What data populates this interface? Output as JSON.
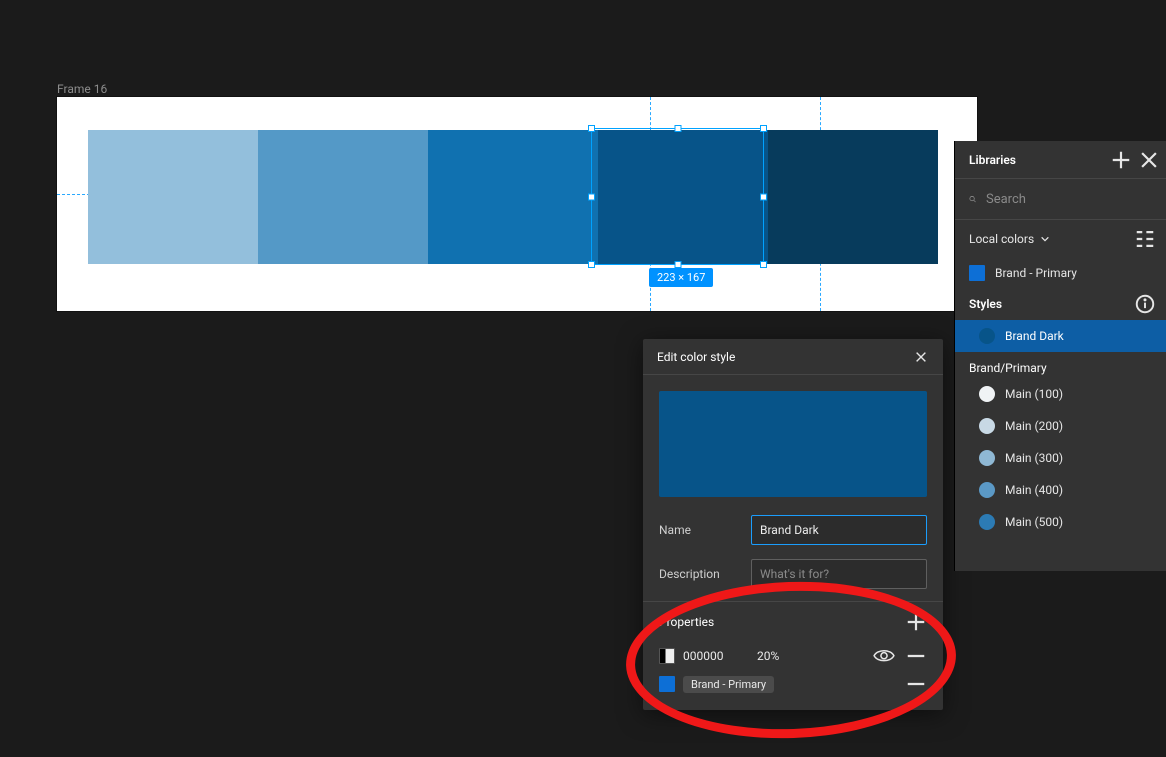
{
  "canvas": {
    "frame_label": "Frame 16",
    "dimension_badge": "223 × 167",
    "swatch_colors": [
      "#93bfdc",
      "#5499c7",
      "#1071b0",
      "#075489",
      "#073b5c"
    ],
    "selected_index": 3
  },
  "edit_panel": {
    "title": "Edit color style",
    "preview_color": "#075489",
    "name_label": "Name",
    "name_value": "Brand Dark",
    "description_label": "Description",
    "description_placeholder": "What's it for?",
    "properties_label": "Properties",
    "overlay": {
      "hex": "000000",
      "opacity": "20%"
    },
    "fill": {
      "name": "Brand - Primary",
      "color": "#0d6fd6"
    }
  },
  "libraries": {
    "title": "Libraries",
    "search_placeholder": "Search",
    "local_label": "Local colors",
    "brand_primary": {
      "label": "Brand - Primary",
      "color": "#0d6fd6"
    },
    "styles_heading": "Styles",
    "selected_style": "Brand Dark",
    "group_label": "Brand/Primary",
    "items": [
      {
        "label": "Main (100)",
        "color": "#f0f3f5"
      },
      {
        "label": "Main (200)",
        "color": "#c8d9e5"
      },
      {
        "label": "Main (300)",
        "color": "#8fb8d4"
      },
      {
        "label": "Main (400)",
        "color": "#5b99c6"
      },
      {
        "label": "Main (500)",
        "color": "#2c7bb4"
      }
    ]
  }
}
